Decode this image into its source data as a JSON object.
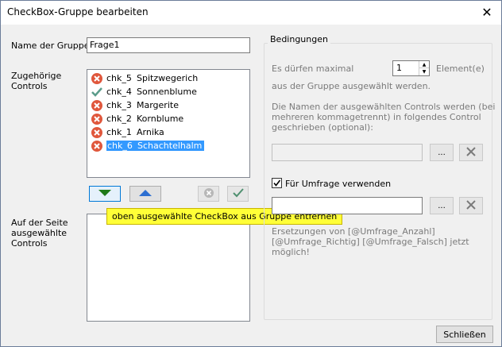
{
  "window": {
    "title": "CheckBox-Gruppe bearbeiten",
    "close_glyph": "✕"
  },
  "group_name": {
    "label": "Name der Gruppe",
    "value": "Frage1"
  },
  "members": {
    "label_line1": "Zugehörige",
    "label_line2": "Controls",
    "items": [
      {
        "name": "chk_5",
        "text": "Spitzwegerich",
        "status": "x-icon",
        "selected": false
      },
      {
        "name": "chk_4",
        "text": "Sonnenblume",
        "status": "check-icon",
        "selected": false
      },
      {
        "name": "chk_3",
        "text": "Margerite",
        "status": "x-icon",
        "selected": false
      },
      {
        "name": "chk_2",
        "text": "Kornblume",
        "status": "x-icon",
        "selected": false
      },
      {
        "name": "chk_1",
        "text": "Arnika",
        "status": "x-icon",
        "selected": false
      },
      {
        "name": "chk_6",
        "text": "Schachtelhalm",
        "status": "x-icon",
        "selected": true
      }
    ]
  },
  "tooltip": {
    "text": "oben ausgewählte CheckBox aus Gruppe entfernen"
  },
  "page_controls": {
    "label_line1": "Auf der Seite",
    "label_line2": "ausgewählte",
    "label_line3": "Controls"
  },
  "conditions": {
    "group_title": "Bedingungen",
    "max_prefix": "Es dürfen maximal",
    "max_value": "1",
    "max_suffix": "Element(e)",
    "max_line2": "aus der Gruppe ausgewählt werden.",
    "names_line1": "Die Namen der ausgewählten Controls werden (bei",
    "names_line2": "mehreren kommagetrennt) in folgendes  Control",
    "names_line3": "geschrieben (optional):",
    "browse_label": "...",
    "survey_checkbox_label": "Für Umfrage verwenden",
    "survey_checked": true,
    "replace_line1": "Ersetzungen von [@Umfrage_Anzahl]",
    "replace_line2": "[@Umfrage_Richtig] [@Umfrage_Falsch] jetzt",
    "replace_line3": "möglich!"
  },
  "footer": {
    "close_button": "Schließen"
  },
  "colors": {
    "selection": "#3399ff",
    "tooltip": "#ffff37",
    "status_error": "#e0573c",
    "status_ok": "#5a9c8a",
    "arrow_blue": "#2d6fd1",
    "arrow_green": "#1f7a18"
  }
}
